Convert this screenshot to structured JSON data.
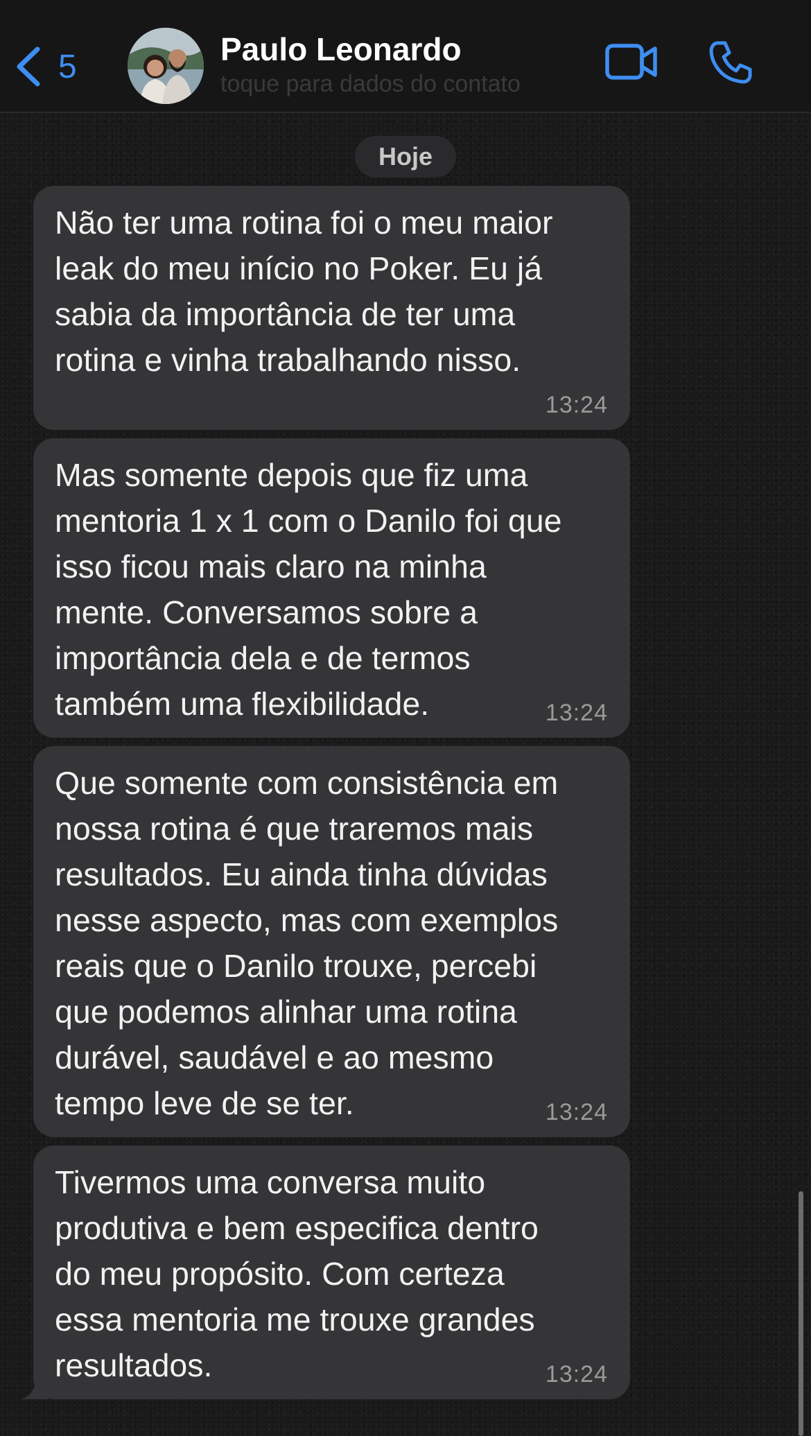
{
  "header": {
    "back_count": "5",
    "contact_name": "Paulo Leonardo",
    "contact_subtitle": "toque para dados do contato"
  },
  "date_separator": "Hoje",
  "messages": [
    {
      "text": "Não ter uma rotina foi o meu maior\nleak do meu início no Poker. Eu já\nsabia da importância de ter uma\nrotina e vinha trabalhando nisso.",
      "time": "13:24"
    },
    {
      "text": "Mas somente depois que fiz uma\nmentoria 1 x 1 com o Danilo foi que\nisso ficou mais claro na minha\nmente. Conversamos sobre a\nimportância dela e de termos\ntambém uma flexibilidade.",
      "time": "13:24"
    },
    {
      "text": "Que somente com consistência em\nnossa rotina é que traremos mais\nresultados. Eu ainda tinha dúvidas\nnesse aspecto, mas com exemplos\nreais que o Danilo trouxe, percebi\nque podemos alinhar uma rotina\ndurável, saudável e ao mesmo\ntempo leve de se ter.",
      "time": "13:24"
    },
    {
      "text": "Tivermos uma conversa muito\nprodutiva e bem especifica dentro\ndo meu propósito. Com certeza\nessa mentoria me trouxe grandes\nresultados.",
      "time": "13:24"
    }
  ],
  "icons": {
    "back": "chevron-left-icon",
    "video": "video-camera-icon",
    "call": "phone-icon"
  },
  "colors": {
    "accent": "#3d8ef0",
    "bubble": "#353537",
    "header": "#161616"
  }
}
